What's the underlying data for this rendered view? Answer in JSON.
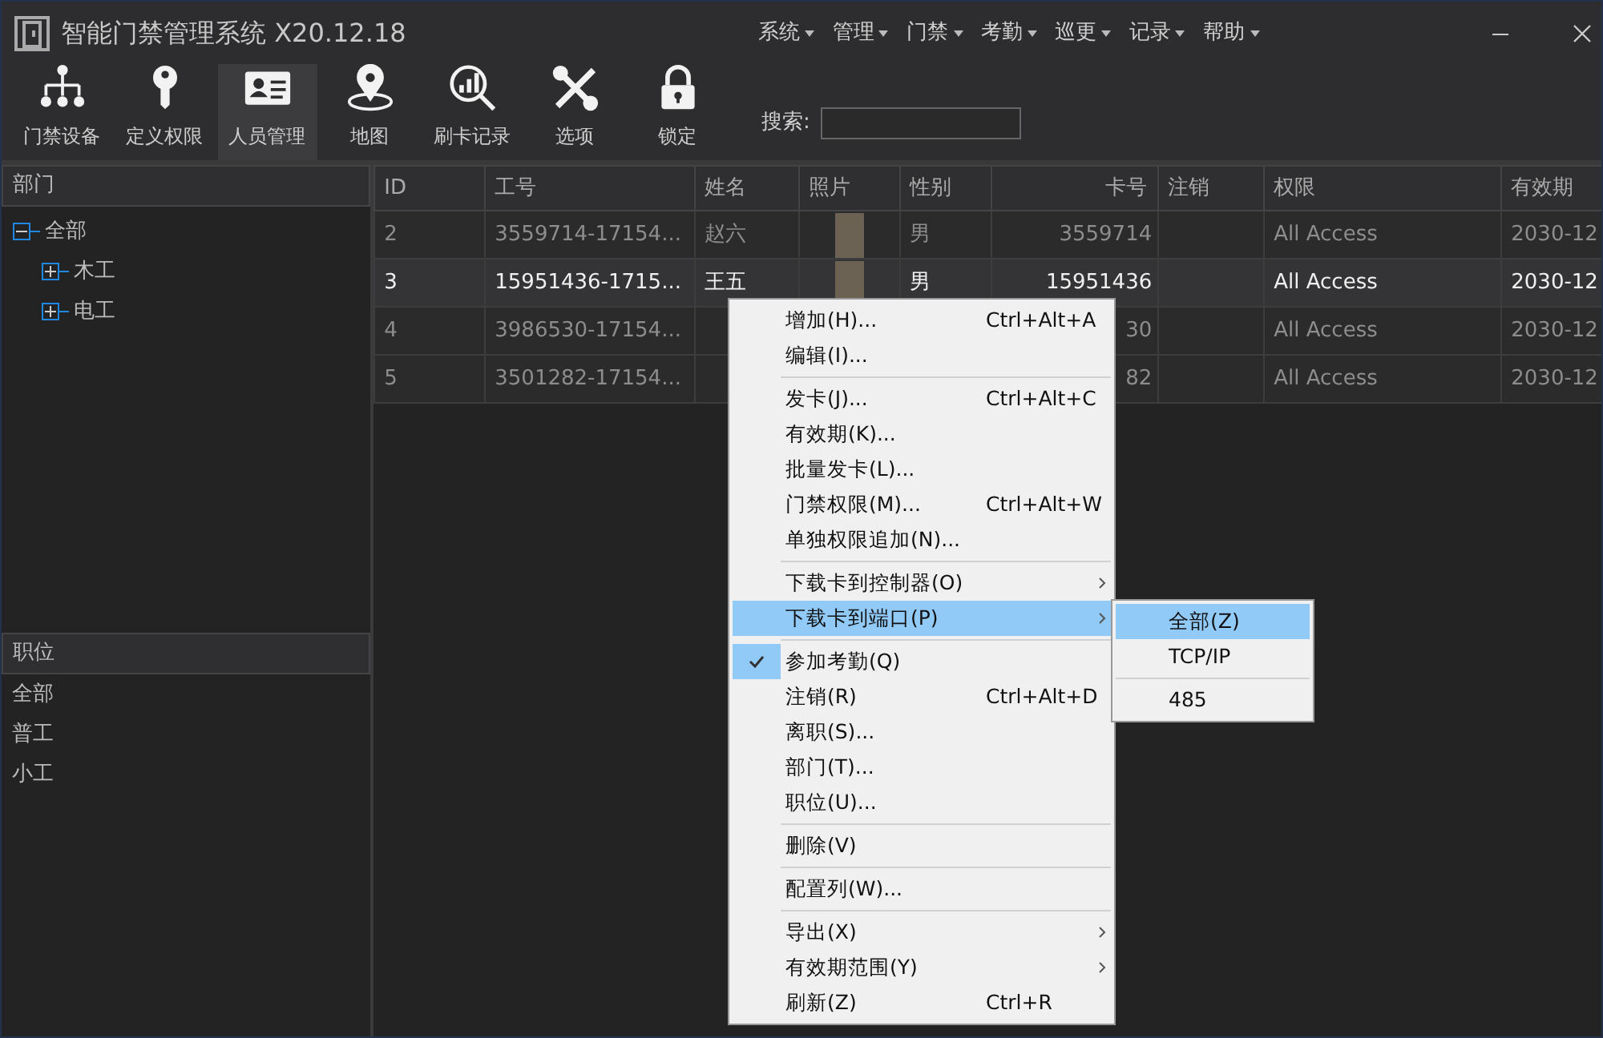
{
  "window": {
    "title": "智能门禁管理系统 X20.12.18"
  },
  "menu_bar": [
    "系统",
    "管理",
    "门禁",
    "考勤",
    "巡更",
    "记录",
    "帮助"
  ],
  "toolbar": [
    {
      "label": "门禁设备",
      "selected": false
    },
    {
      "label": "定义权限",
      "selected": false
    },
    {
      "label": "人员管理",
      "selected": true
    },
    {
      "label": "地图",
      "selected": false
    },
    {
      "label": "刷卡记录",
      "selected": false
    },
    {
      "label": "选项",
      "selected": false
    },
    {
      "label": "锁定",
      "selected": false
    }
  ],
  "search": {
    "label": "搜索:"
  },
  "departments": {
    "title": "部门",
    "tree": [
      {
        "label": "全部",
        "expanded": true,
        "children": [
          {
            "label": "木工",
            "expanded": false
          },
          {
            "label": "电工",
            "expanded": false
          }
        ]
      }
    ]
  },
  "positions": {
    "title": "职位",
    "items": [
      "全部",
      "普工",
      "小工"
    ]
  },
  "table": {
    "columns": [
      "ID",
      "工号",
      "姓名",
      "照片",
      "性别",
      "卡号",
      "注销",
      "权限",
      "有效期"
    ],
    "rows": [
      {
        "id": "2",
        "emp_no": "3559714-17154...",
        "name": "赵六",
        "gender": "男",
        "card": "3559714",
        "permission": "All Access",
        "expiry": "2030-12",
        "selected": false
      },
      {
        "id": "3",
        "emp_no": "15951436-1715...",
        "name": "王五",
        "gender": "男",
        "card": "15951436",
        "permission": "All Access",
        "expiry": "2030-12",
        "selected": true
      },
      {
        "id": "4",
        "emp_no": "3986530-17154...",
        "card": "30",
        "permission": "All Access",
        "expiry": "2030-12",
        "selected": false
      },
      {
        "id": "5",
        "emp_no": "3501282-17154...",
        "card": "82",
        "permission": "All Access",
        "expiry": "2030-12",
        "selected": false
      }
    ]
  },
  "context_menu": [
    {
      "kind": "item",
      "label": "增加(H)...",
      "shortcut": "Ctrl+Alt+A"
    },
    {
      "kind": "item",
      "label": "编辑(I)..."
    },
    {
      "kind": "separator"
    },
    {
      "kind": "item",
      "label": "发卡(J)...",
      "shortcut": "Ctrl+Alt+C"
    },
    {
      "kind": "item",
      "label": "有效期(K)..."
    },
    {
      "kind": "item",
      "label": "批量发卡(L)..."
    },
    {
      "kind": "item",
      "label": "门禁权限(M)...",
      "shortcut": "Ctrl+Alt+W"
    },
    {
      "kind": "item",
      "label": "单独权限追加(N)..."
    },
    {
      "kind": "separator"
    },
    {
      "kind": "submenu",
      "label": "下载卡到控制器(O)",
      "selected": false
    },
    {
      "kind": "submenu",
      "label": "下载卡到端口(P)",
      "selected": true
    },
    {
      "kind": "separator"
    },
    {
      "kind": "check",
      "label": "参加考勤(Q)",
      "checked": true
    },
    {
      "kind": "item",
      "label": "注销(R)",
      "shortcut": "Ctrl+Alt+D"
    },
    {
      "kind": "item",
      "label": "离职(S)..."
    },
    {
      "kind": "item",
      "label": "部门(T)..."
    },
    {
      "kind": "item",
      "label": "职位(U)..."
    },
    {
      "kind": "separator"
    },
    {
      "kind": "item",
      "label": "删除(V)"
    },
    {
      "kind": "separator"
    },
    {
      "kind": "item",
      "label": "配置列(W)..."
    },
    {
      "kind": "separator"
    },
    {
      "kind": "submenu",
      "label": "导出(X)",
      "selected": false
    },
    {
      "kind": "submenu",
      "label": "有效期范围(Y)",
      "selected": false
    },
    {
      "kind": "item",
      "label": "刷新(Z)",
      "shortcut": "Ctrl+R"
    }
  ],
  "submenu": [
    {
      "kind": "item",
      "label": "全部(Z)",
      "selected": true
    },
    {
      "kind": "item",
      "label": "TCP/IP",
      "selected": false
    },
    {
      "kind": "separator"
    },
    {
      "kind": "item",
      "label": "485",
      "selected": false
    }
  ]
}
